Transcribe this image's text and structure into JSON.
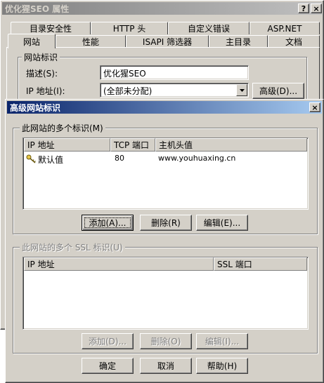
{
  "back_window": {
    "title": "优化猩SEO 属性",
    "help_glyph": "?",
    "close_glyph": "×",
    "tabs_row1": [
      "目录安全性",
      "HTTP 头",
      "自定义错误",
      "ASP.NET"
    ],
    "tabs_row2": [
      "网站",
      "性能",
      "ISAPI 筛选器",
      "主目录",
      "文档"
    ],
    "group_title": "网站标识",
    "description_label": "描述(S):",
    "description_value": "优化猩SEO",
    "ip_label": "IP 地址(I):",
    "ip_value": "(全部未分配)",
    "advanced_button": "高级(D)..."
  },
  "dialog": {
    "title": "高级网站标识",
    "close_glyph": "×",
    "identities": {
      "group_title": "此网站的多个标识(M)",
      "columns": [
        "IP 地址",
        "TCP 端口",
        "主机头值"
      ],
      "rows": [
        {
          "ip": "默认值",
          "port": "80",
          "host": "www.youhuaxing.cn"
        }
      ],
      "add_button": "添加(A)...",
      "remove_button": "删除(R)",
      "edit_button": "编辑(E)..."
    },
    "ssl": {
      "group_title": "此网站的多个 SSL 标识(U)",
      "columns": [
        "IP 地址",
        "SSL 端口"
      ],
      "add_button": "添加(D)...",
      "remove_button": "删除(O)",
      "edit_button": "编辑(I)..."
    },
    "ok_button": "确定",
    "cancel_button": "取消",
    "help_button": "帮助(H)"
  },
  "colors": {
    "face": "#d4d0c8",
    "back_title_bg": "#808080",
    "dialog_title_start": "#0a246a",
    "dialog_title_end": "#a6caf0"
  }
}
